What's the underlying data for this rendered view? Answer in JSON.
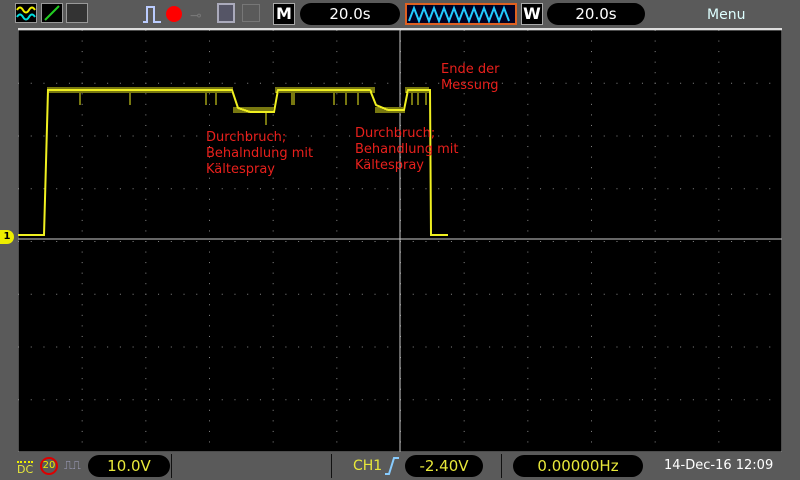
{
  "toolbar": {
    "timebase_label": "M",
    "timebase": "20.0s",
    "window_label": "W",
    "window": "20.0s",
    "menu": "Menu"
  },
  "screen": {
    "annotations": [
      {
        "lines": "Durchbruch;\nBehalndlung mit\nKältespray"
      },
      {
        "lines": "Durchbruch;\nBehandlung mit\nKältespray"
      },
      {
        "lines": "Ende der\nMessung"
      }
    ],
    "channel_marker": "1",
    "trace_color": "#f0f020"
  },
  "status": {
    "coupling": "DC",
    "bw_limit": "20",
    "volts_div": "10.0V",
    "trigger_source": "CH1",
    "trigger_level": "-2.40V",
    "frequency": "0.00000Hz",
    "datetime": "14-Dec-16 12:09"
  }
}
